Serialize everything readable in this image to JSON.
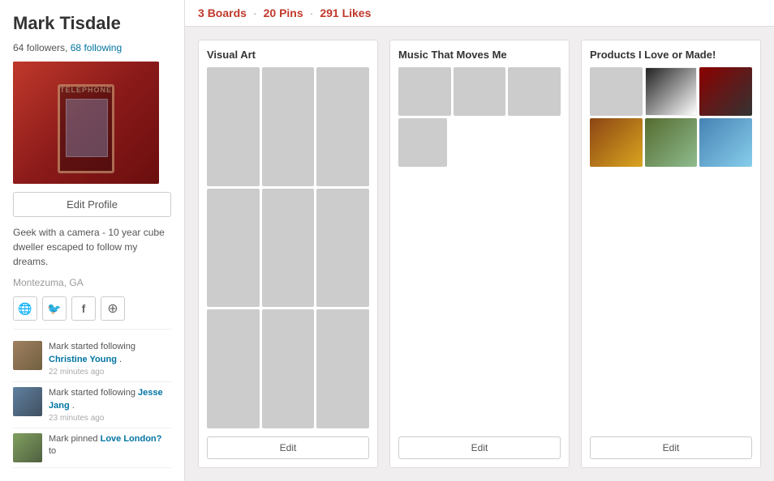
{
  "sidebar": {
    "user_name": "Mark Tisdale",
    "followers_count": "64",
    "following_count": "68",
    "followers_label": "followers",
    "following_label": "following",
    "edit_profile_label": "Edit Profile",
    "bio": "Geek with a camera - 10 year cube dweller escaped to follow my dreams.",
    "location": "Montezuma, GA",
    "social_icons": [
      {
        "name": "globe-icon",
        "symbol": "🌐"
      },
      {
        "name": "twitter-icon",
        "symbol": "🐦"
      },
      {
        "name": "facebook-icon",
        "symbol": "f"
      },
      {
        "name": "rss-icon",
        "symbol": "⊕"
      }
    ]
  },
  "activity": [
    {
      "id": 1,
      "action": "Mark started following",
      "target": "Christine Young",
      "suffix": ".",
      "time": "22 minutes ago"
    },
    {
      "id": 2,
      "action": "Mark started following",
      "target": "Jesse Jang",
      "suffix": ".",
      "time": "23 minutes ago"
    },
    {
      "id": 3,
      "action": "Mark pinned",
      "target": "Love London?",
      "suffix": " to",
      "time": ""
    }
  ],
  "topbar": {
    "boards_count": "3",
    "boards_label": "Boards",
    "pins_count": "20",
    "pins_label": "Pins",
    "likes_count": "291",
    "likes_label": "Likes",
    "dot": "·"
  },
  "boards": [
    {
      "id": "visual-art",
      "title": "Visual Art",
      "edit_label": "Edit",
      "layout": "3x3"
    },
    {
      "id": "music",
      "title": "Music That Moves Me",
      "edit_label": "Edit",
      "layout": "music"
    },
    {
      "id": "products",
      "title": "Products I Love or Made!",
      "edit_label": "Edit",
      "layout": "products"
    }
  ]
}
